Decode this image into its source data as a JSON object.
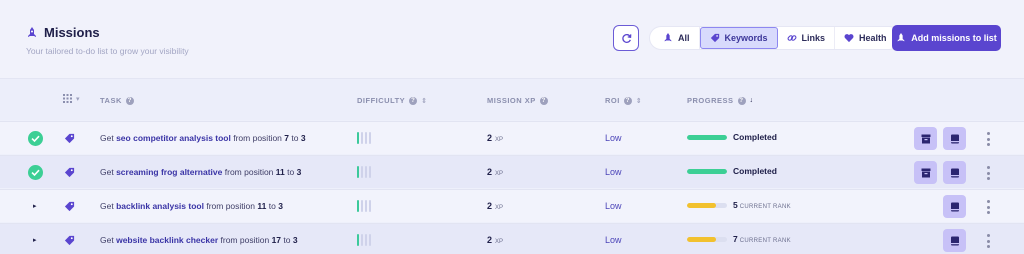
{
  "header": {
    "title": "Missions",
    "subtitle": "Your tailored to-do list to grow your visibility"
  },
  "filters": [
    {
      "label": "All",
      "icon": "rocket-icon",
      "active": false
    },
    {
      "label": "Keywords",
      "icon": "tag-icon",
      "active": true
    },
    {
      "label": "Links",
      "icon": "link-icon",
      "active": false
    },
    {
      "label": "Health",
      "icon": "heart-icon",
      "active": false
    }
  ],
  "add_button": {
    "label": "Add missions to list"
  },
  "columns": {
    "task": "TASK",
    "difficulty": "DIFFICULTY",
    "mission_xp": "MISSION XP",
    "roi": "ROI",
    "progress": "PROGRESS"
  },
  "rows": [
    {
      "status": "completed",
      "prefix": "Get",
      "keyword": "seo competitor analysis tool",
      "mid": "from position",
      "from": "7",
      "to_word": "to",
      "to": "3",
      "difficulty_level": 1,
      "xp": "2",
      "xp_unit": "XP",
      "roi": "Low",
      "progress_fraction": 1.0,
      "progress_color": "#3ccf95",
      "progress_label": "Completed",
      "rank": "",
      "rank_unit": ""
    },
    {
      "status": "completed",
      "prefix": "Get",
      "keyword": "screaming frog alternative",
      "mid": "from position",
      "from": "11",
      "to_word": "to",
      "to": "3",
      "difficulty_level": 1,
      "xp": "2",
      "xp_unit": "XP",
      "roi": "Low",
      "progress_fraction": 1.0,
      "progress_color": "#3ccf95",
      "progress_label": "Completed",
      "rank": "",
      "rank_unit": ""
    },
    {
      "status": "pending",
      "prefix": "Get",
      "keyword": "backlink analysis tool",
      "mid": "from position",
      "from": "11",
      "to_word": "to",
      "to": "3",
      "difficulty_level": 1,
      "xp": "2",
      "xp_unit": "XP",
      "roi": "Low",
      "progress_fraction": 0.72,
      "progress_color": "#f2c12e",
      "progress_label": "",
      "rank": "5",
      "rank_unit": "CURRENT RANK"
    },
    {
      "status": "pending",
      "prefix": "Get",
      "keyword": "website backlink checker",
      "mid": "from position",
      "from": "17",
      "to_word": "to",
      "to": "3",
      "difficulty_level": 1,
      "xp": "2",
      "xp_unit": "XP",
      "roi": "Low",
      "progress_fraction": 0.72,
      "progress_color": "#f2c12e",
      "progress_label": "",
      "rank": "7",
      "rank_unit": "CURRENT RANK"
    }
  ],
  "colors": {
    "accent": "#5a45cf",
    "completed": "#3ccf95",
    "in_progress": "#f2c12e"
  }
}
